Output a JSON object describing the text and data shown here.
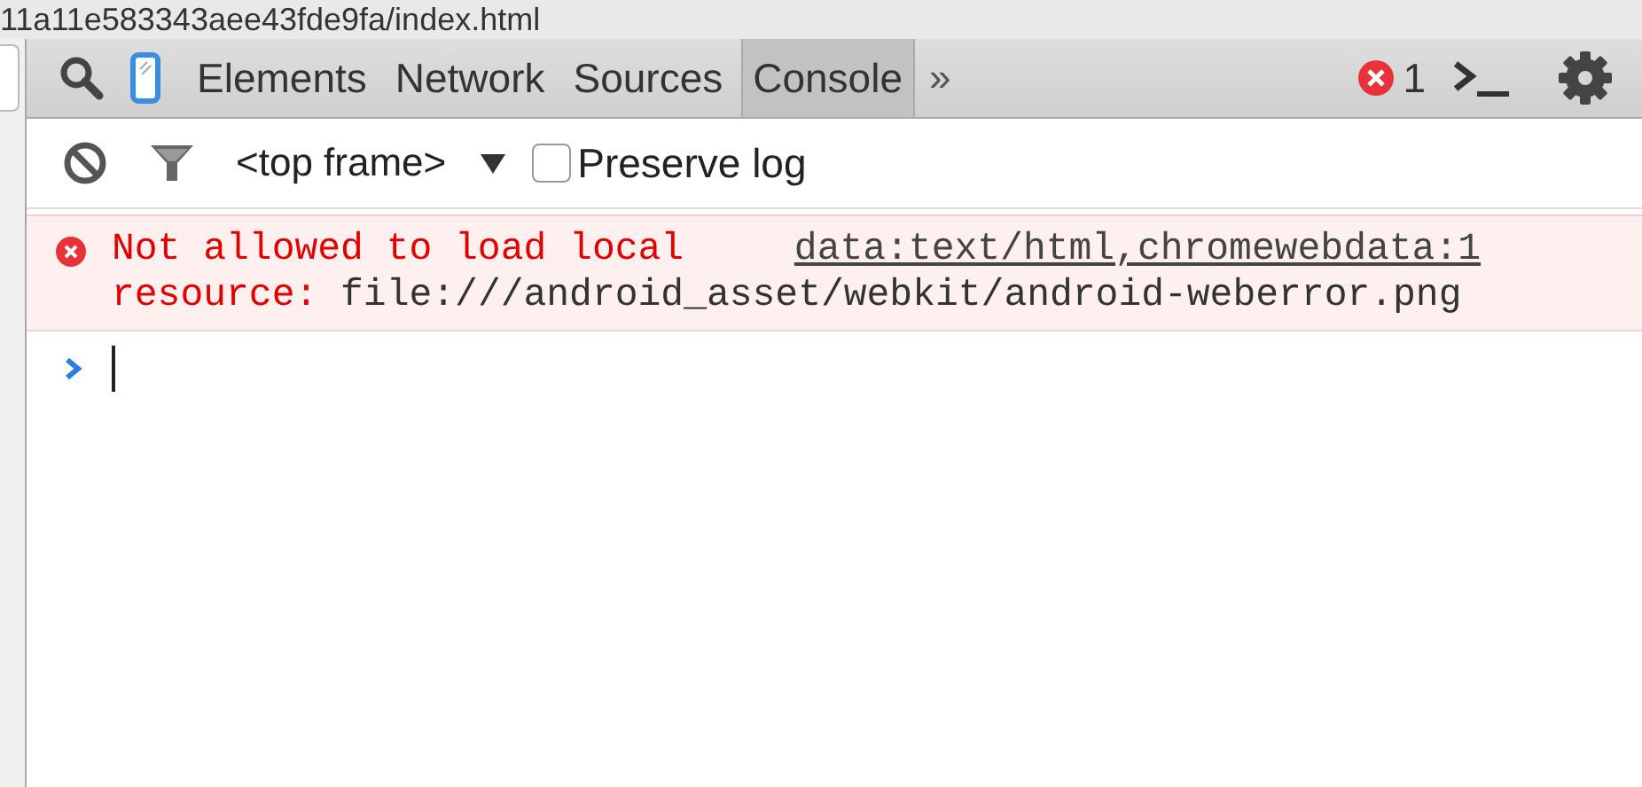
{
  "page": {
    "url": "11a11e583343aee43fde9fa/index.html"
  },
  "toolbar": {
    "tabs": [
      {
        "label": "Elements",
        "selected": false
      },
      {
        "label": "Network",
        "selected": false
      },
      {
        "label": "Sources",
        "selected": false
      },
      {
        "label": "Console",
        "selected": true
      }
    ],
    "more": "»",
    "error_count": "1"
  },
  "filter_bar": {
    "frame": "<top frame>",
    "preserve_log": {
      "label": "Preserve log",
      "checked": false
    }
  },
  "messages": [
    {
      "kind": "error",
      "text_lines": [
        "Not allowed to load local",
        "resource:"
      ],
      "url": "file:///android_asset/webkit/android-weberror.png",
      "source": "data:text/html,chromewebdata:1"
    }
  ]
}
